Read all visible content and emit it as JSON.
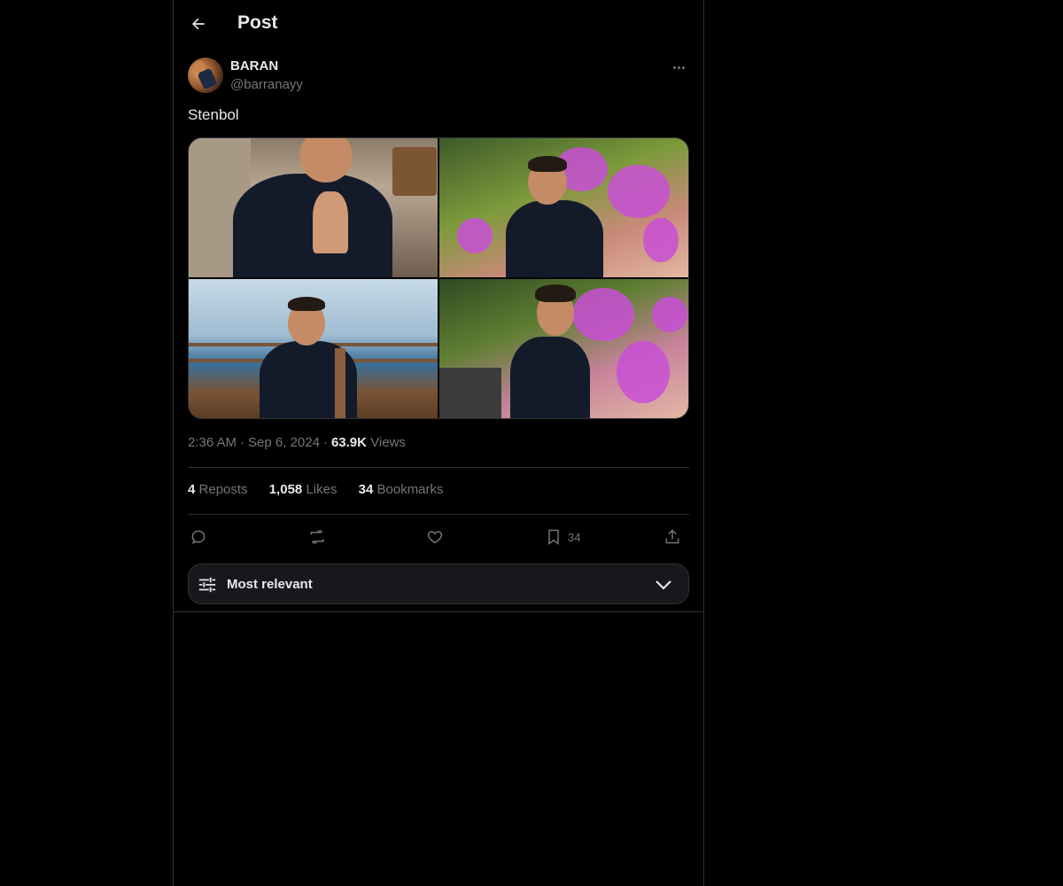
{
  "header": {
    "title": "Post"
  },
  "tweet": {
    "display_name": "BARAN",
    "handle": "@barranayy",
    "text": "Stenbol",
    "time": "2:36 AM",
    "date": "Sep 6, 2024",
    "views_count": "63.9K",
    "views_label": "Views"
  },
  "stats": {
    "reposts_count": "4",
    "reposts_label": "Reposts",
    "likes_count": "1,058",
    "likes_label": "Likes",
    "bookmarks_count": "34",
    "bookmarks_label": "Bookmarks"
  },
  "actions": {
    "reply_icon": "reply-icon",
    "repost_icon": "repost-icon",
    "like_icon": "heart-icon",
    "bookmark_icon": "bookmark-icon",
    "bookmark_count": "34",
    "share_icon": "share-icon"
  },
  "sort": {
    "label": "Most relevant"
  },
  "colors": {
    "background": "#000000",
    "text": "#e7e9ea",
    "muted": "#71767b",
    "border": "#2f3336",
    "sort_bg": "#16181c"
  }
}
